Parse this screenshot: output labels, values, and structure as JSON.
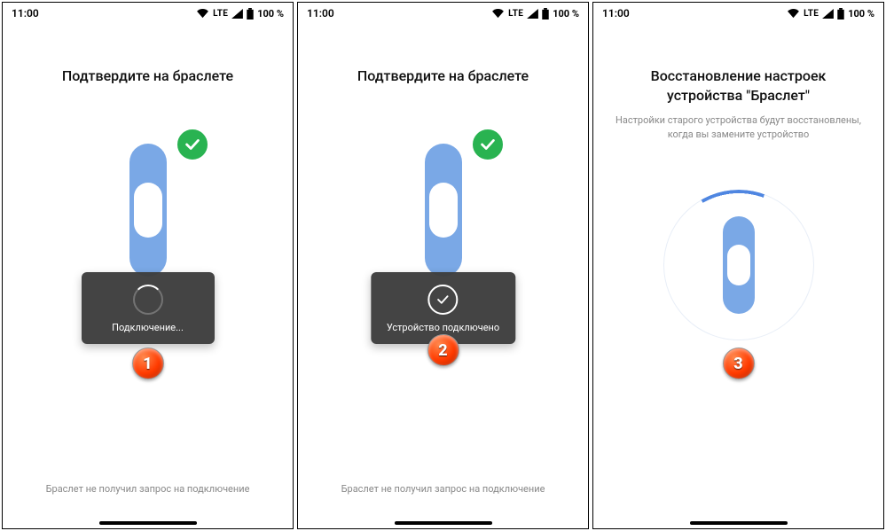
{
  "status": {
    "time": "11:00",
    "lte": "LTE",
    "battery": "100 %"
  },
  "screens": [
    {
      "title": "Подтвердите на браслете",
      "toast": "Подключение...",
      "footer": "Браслет не получил запрос на подключение",
      "step": "1"
    },
    {
      "title": "Подтвердите на браслете",
      "toast": "Устройство подключено",
      "footer": "Браслет не получил запрос на подключение",
      "step": "2"
    },
    {
      "title": "Восстановление настроек устройства \"Браслет\"",
      "subtitle": "Настройки старого устройства будут восстановлены, когда вы замените устройство",
      "step": "3"
    }
  ]
}
